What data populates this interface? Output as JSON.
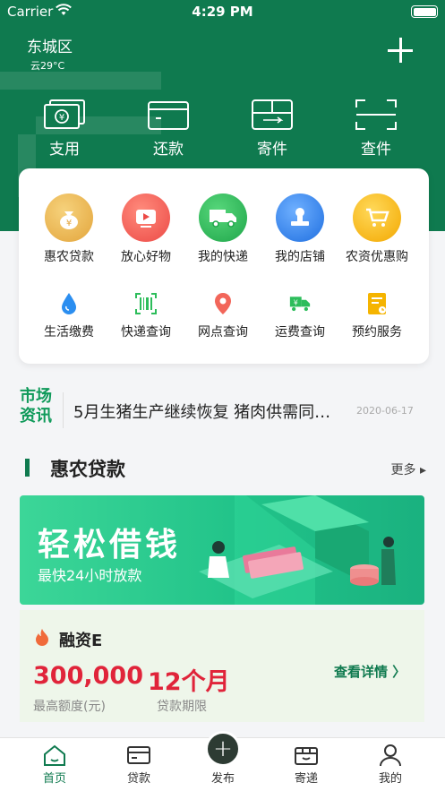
{
  "status": {
    "carrier": "Carrier",
    "time": "4:29 PM"
  },
  "location": {
    "city": "东城区",
    "weather": "云29°C"
  },
  "quick_actions": [
    {
      "label": "支用",
      "icon": "wallet-icon"
    },
    {
      "label": "还款",
      "icon": "card-icon"
    },
    {
      "label": "寄件",
      "icon": "mailbox-icon"
    },
    {
      "label": "查件",
      "icon": "scan-icon"
    }
  ],
  "services_row1": [
    {
      "label": "惠农贷款",
      "icon": "money-bag-icon",
      "color": "#e8b04a"
    },
    {
      "label": "放心好物",
      "icon": "video-icon",
      "color": "#f25c54"
    },
    {
      "label": "我的快递",
      "icon": "truck-icon",
      "color": "#2dbd5b"
    },
    {
      "label": "我的店铺",
      "icon": "stamp-icon",
      "color": "#2f80ed"
    },
    {
      "label": "农资优惠购",
      "icon": "cart-icon",
      "color": "#ffc107"
    }
  ],
  "services_row2": [
    {
      "label": "生活缴费",
      "icon": "water-drop-icon",
      "color": "#2b8ef0"
    },
    {
      "label": "快递查询",
      "icon": "barcode-icon",
      "color": "#2dbd5b"
    },
    {
      "label": "网点查询",
      "icon": "location-pin-icon",
      "color": "#f2665a"
    },
    {
      "label": "运费查询",
      "icon": "yuan-truck-icon",
      "color": "#2dbd5b"
    },
    {
      "label": "预约服务",
      "icon": "clipboard-icon",
      "color": "#f5b400"
    }
  ],
  "news": {
    "tag": "市场资讯",
    "tag_line1": "市场",
    "tag_line2": "资讯",
    "headline": "5月生猪生产继续恢复 猪肉供需同…",
    "date": "2020-06-17"
  },
  "section": {
    "title": "惠农贷款",
    "more": "更多 ▸"
  },
  "banner": {
    "title": "轻松借钱",
    "subtitle": "最快24小时放款"
  },
  "loan": {
    "name": "融资E",
    "amount": "300,000",
    "amount_label": "最高额度(元)",
    "term": "12个月",
    "term_label": "贷款期限",
    "detail": "查看详情 〉"
  },
  "tabs": [
    {
      "label": "首页",
      "icon": "home-icon",
      "active": true
    },
    {
      "label": "贷款",
      "icon": "card-icon"
    },
    {
      "label": "发布",
      "icon": "plus-icon"
    },
    {
      "label": "寄递",
      "icon": "package-icon"
    },
    {
      "label": "我的",
      "icon": "user-icon"
    }
  ],
  "colors": {
    "brand": "#0f7a4f",
    "accent_red": "#e0243a",
    "news_green": "#0f9a5a"
  }
}
